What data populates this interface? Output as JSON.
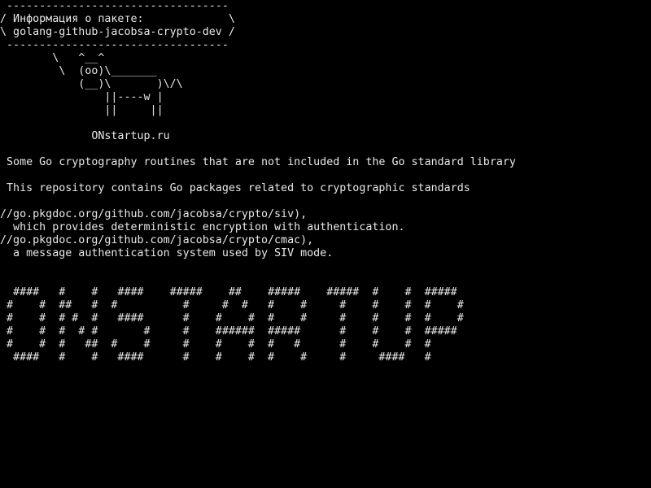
{
  "terminal": {
    "background": "#000000",
    "foreground": "#e8e8e8",
    "cowsay": {
      "bubble_top": " ----------------------------------",
      "bubble_line1": "/ Информация о пакете:             \\",
      "bubble_line2": "\\ golang-github-jacobsa-crypto-dev /",
      "bubble_bottom": " ----------------------------------",
      "cow_line1": "        \\   ^__^",
      "cow_line2": "         \\  (oo)\\_______",
      "cow_line3": "            (__)\\       )\\/\\",
      "cow_line4": "                ||----w |",
      "cow_line5": "                ||     ||",
      "site": "              ONstartup.ru"
    },
    "description": {
      "summary": " Some Go cryptography routines that are not included in the Go standard library",
      "detail": " This repository contains Go packages related to cryptographic standards",
      "siv_link": "//go.pkgdoc.org/github.com/jacobsa/crypto/siv),",
      "siv_text": "  which provides deterministic encryption with authentication.",
      "cmac_link": "//go.pkgdoc.org/github.com/jacobsa/crypto/cmac),",
      "cmac_text": "  a message authentication system used by SIV mode."
    },
    "banner": {
      "row1": "  ####   #    #   ####    #####    ##    #####    #####  #    #  #####",
      "row2": " #    #  ##   #  #          #     #  #   #    #     #    #    #  #    #",
      "row3": " #    #  # #  #   ####      #    #    #  #    #     #    #    #  #    #",
      "row4": " #    #  #  # #       #     #    ######  #####      #    #    #  #####",
      "row5": " #    #  #   ##  #    #     #    #    #  #   #      #    #    #  #",
      "row6": "  ####   #    #   ####      #    #    #  #    #     #     ####   #"
    }
  }
}
